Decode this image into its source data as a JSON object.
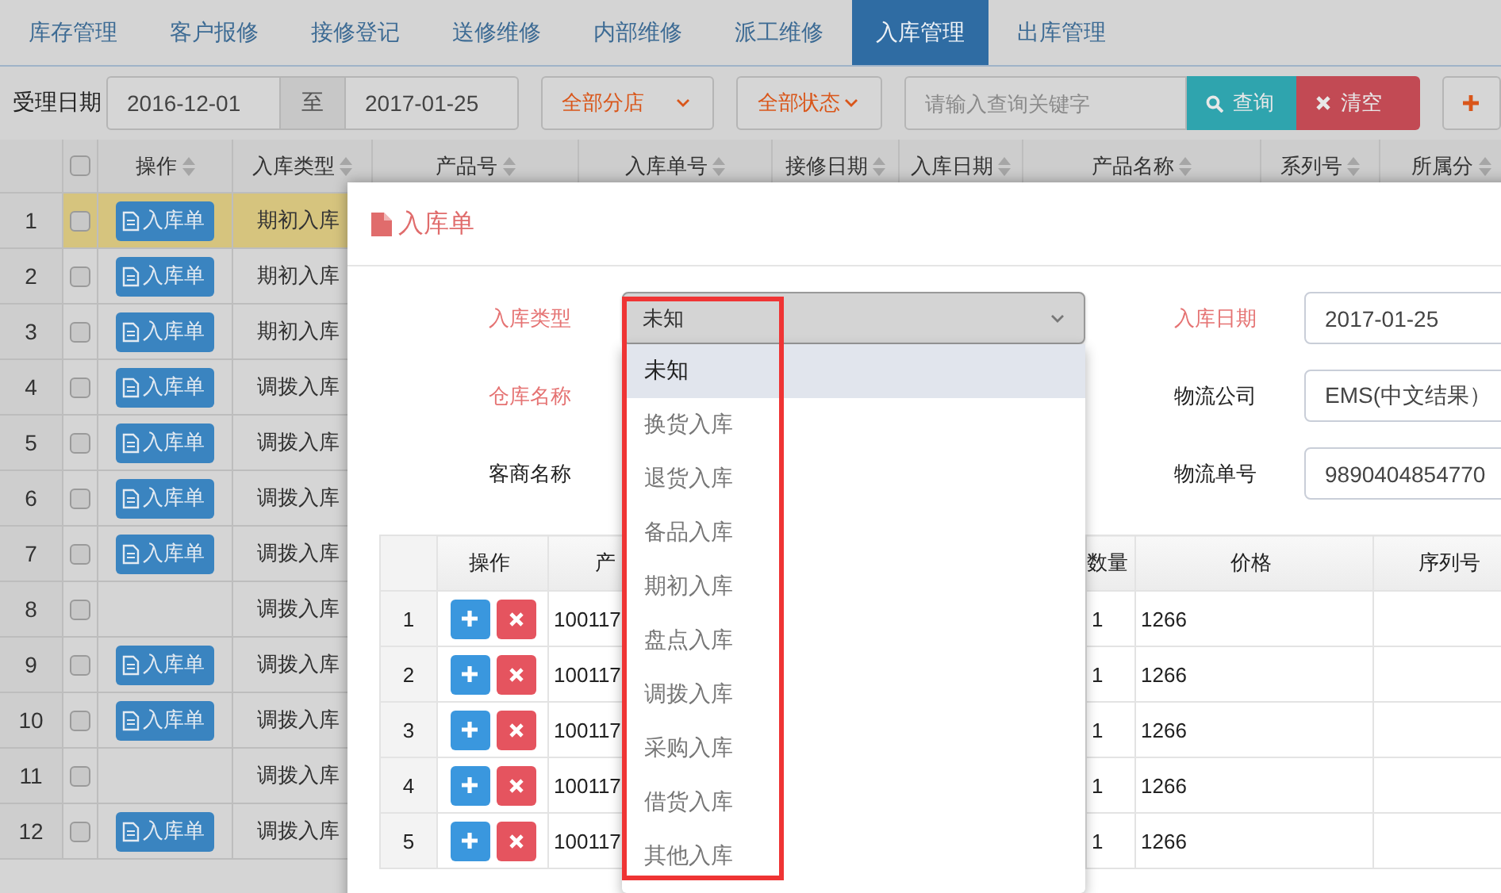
{
  "tabs": [
    {
      "label": "库存管理",
      "selected": false
    },
    {
      "label": "客户报修",
      "selected": false
    },
    {
      "label": "接修登记",
      "selected": false
    },
    {
      "label": "送修维修",
      "selected": false
    },
    {
      "label": "内部维修",
      "selected": false
    },
    {
      "label": "派工维修",
      "selected": false
    },
    {
      "label": "入库管理",
      "selected": true
    },
    {
      "label": "出库管理",
      "selected": false
    }
  ],
  "filter": {
    "date_label": "受理日期",
    "date_from": "2016-12-01",
    "date_separator": "至",
    "date_to": "2017-01-25",
    "branch_select": "全部分店",
    "status_select": "全部状态",
    "search": {
      "placeholder": "请输入查询关键字"
    },
    "buttons": [
      {
        "label": "查询",
        "kind": "search"
      },
      {
        "label": "清空",
        "kind": "clear"
      },
      {
        "kind": "add"
      }
    ]
  },
  "table": {
    "all_checked": false,
    "columns": [
      "操作",
      "入库类型",
      "产品号",
      "入库单号",
      "接修日期",
      "入库日期",
      "产品名称",
      "系列号",
      "所属分"
    ],
    "rows": [
      {
        "number": "1",
        "checked": false,
        "selected": true,
        "action": "入库单",
        "type": "期初入库"
      },
      {
        "number": "2",
        "checked": false,
        "selected": false,
        "action": "入库单",
        "type": "期初入库"
      },
      {
        "number": "3",
        "checked": false,
        "selected": false,
        "action": "入库单",
        "type": "期初入库"
      },
      {
        "number": "4",
        "checked": false,
        "selected": false,
        "action": "入库单",
        "type": "调拨入库"
      },
      {
        "number": "5",
        "checked": false,
        "selected": false,
        "action": "入库单",
        "type": "调拨入库"
      },
      {
        "number": "6",
        "checked": false,
        "selected": false,
        "action": "入库单",
        "type": "调拨入库"
      },
      {
        "number": "7",
        "checked": false,
        "selected": false,
        "action": "入库单",
        "type": "调拨入库"
      },
      {
        "number": "8",
        "checked": false,
        "selected": false,
        "type": "调拨入库"
      },
      {
        "number": "9",
        "checked": false,
        "selected": false,
        "action": "入库单",
        "type": "调拨入库"
      },
      {
        "number": "10",
        "checked": false,
        "selected": false,
        "action": "入库单",
        "type": "调拨入库"
      },
      {
        "number": "11",
        "checked": false,
        "selected": false,
        "type": "调拨入库"
      },
      {
        "number": "12",
        "checked": false,
        "selected": false,
        "action": "入库单",
        "type": "调拨入库"
      }
    ]
  },
  "modal": {
    "title": "入库单",
    "form": [
      {
        "label": "入库类型",
        "required": true,
        "value": "未知",
        "kind": "select"
      },
      {
        "label": "入库日期",
        "required": true,
        "value": "2017-01-25",
        "kind": "text"
      },
      {
        "label": "仓库名称",
        "required": true
      },
      {
        "label": "物流公司",
        "required": false,
        "value": "EMS(中文结果）",
        "kind": "text"
      },
      {
        "label": "客商名称",
        "required": false
      },
      {
        "label": "物流单号",
        "required": false,
        "value": "9890404854770",
        "kind": "text"
      }
    ],
    "dropdown": [
      {
        "label": "未知",
        "selected": true
      },
      {
        "label": "换货入库",
        "selected": false
      },
      {
        "label": "退货入库",
        "selected": false
      },
      {
        "label": "备品入库",
        "selected": false
      },
      {
        "label": "期初入库",
        "selected": false
      },
      {
        "label": "盘点入库",
        "selected": false
      },
      {
        "label": "调拨入库",
        "selected": false
      },
      {
        "label": "采购入库",
        "selected": false
      },
      {
        "label": "借货入库",
        "selected": false
      },
      {
        "label": "其他入库",
        "selected": false
      }
    ],
    "items": {
      "columns": [
        "操作",
        "产",
        "数量",
        "价格",
        "序列号"
      ],
      "rows": [
        {
          "number": "1",
          "product": "100117",
          "quantity": "1",
          "price": "1266"
        },
        {
          "number": "2",
          "product": "100117",
          "quantity": "1",
          "price": "1266"
        },
        {
          "number": "3",
          "product": "100117",
          "quantity": "1",
          "price": "1266"
        },
        {
          "number": "4",
          "product": "100117",
          "quantity": "1",
          "price": "1266"
        },
        {
          "number": "5",
          "product": "100117",
          "quantity": "1",
          "price": "1266"
        }
      ]
    }
  }
}
